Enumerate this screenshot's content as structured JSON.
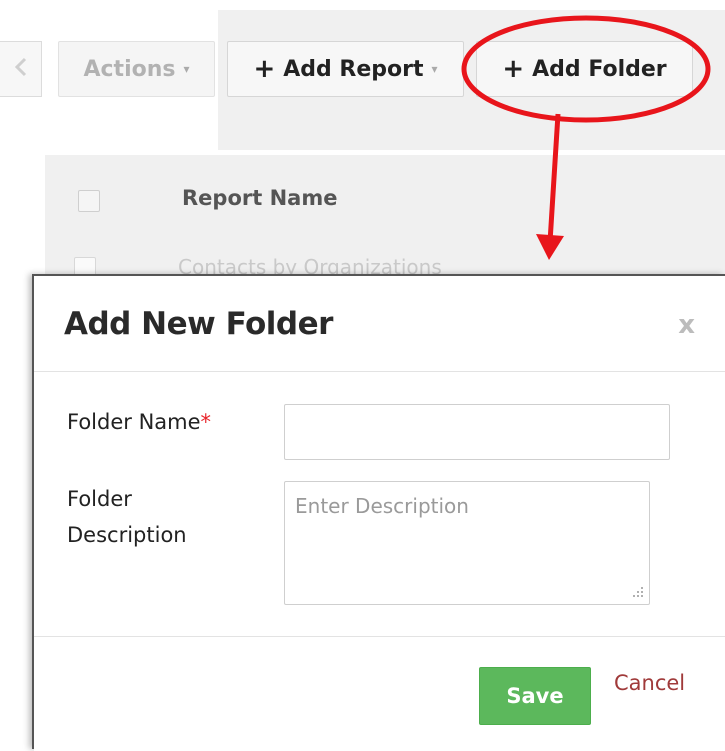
{
  "toolbar": {
    "back_icon": "chevron-left-icon",
    "actions_label": "Actions",
    "add_report_label": "Add Report",
    "add_folder_label": "Add Folder",
    "plus_glyph": "+",
    "caret_glyph": "▾"
  },
  "highlight_color": "#e8151b",
  "report_list": {
    "header_label": "Report Name",
    "rows": [
      "Contacts by Organizations"
    ]
  },
  "modal": {
    "title": "Add New Folder",
    "close_label": "x",
    "folder_name_label": "Folder Name",
    "required_mark": "*",
    "folder_name_value": "",
    "description_label_line1": "Folder",
    "description_label_line2": "Description",
    "description_placeholder": "Enter Description",
    "save_label": "Save",
    "cancel_label": "Cancel"
  }
}
